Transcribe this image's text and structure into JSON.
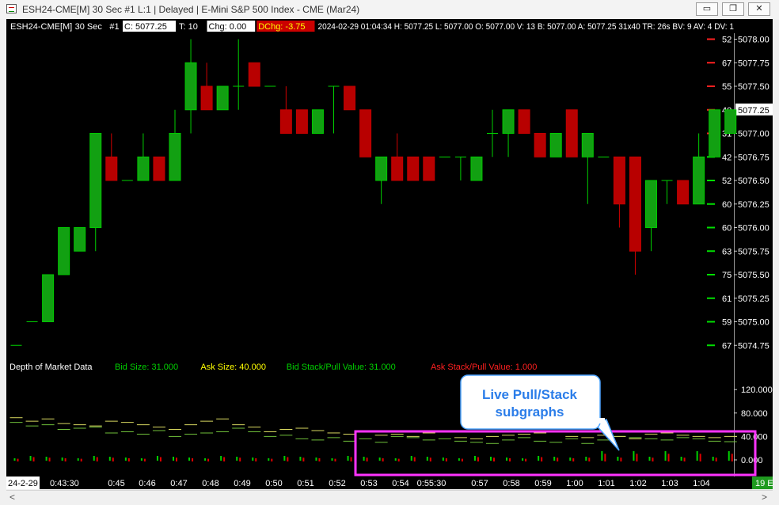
{
  "window": {
    "title": "ESH24-CME[M]  30 Sec  #1 L:1 | Delayed | E-Mini S&P 500 Index - CME (Mar24)",
    "minimize_glyph": "▭",
    "restore_glyph": "❐",
    "close_glyph": "✕"
  },
  "header": {
    "symbol": "ESH24-CME[M]",
    "interval": "30 Sec",
    "chart_num": "#1",
    "c_label": "C: 5077.25",
    "t_label": "T: 10",
    "chg_label": "Chg: 0.00",
    "dchg_label": "DChg: -3.75",
    "rest": "2024-02-29 01:04:34 H: 5077.25 L: 5077.00 O: 5077.00 V: 13 B: 5077.00 A: 5077.25 31x40 TR: 26s BV: 9 AV: 4 DV: 1"
  },
  "price_axis": {
    "labels": [
      "5078.00",
      "5077.75",
      "5077.50",
      "5077.25",
      "5077.00",
      "5076.75",
      "5076.50",
      "5076.25",
      "5076.00",
      "5075.75",
      "5075.50",
      "5075.25",
      "5075.00",
      "5074.75"
    ],
    "current_price": "5077.25"
  },
  "dom_ladder": [
    {
      "price": 5078.0,
      "size": "52",
      "color": "#ff2020"
    },
    {
      "price": 5077.75,
      "size": "67",
      "color": "#ff2020"
    },
    {
      "price": 5077.5,
      "size": "55",
      "color": "#ff2020"
    },
    {
      "price": 5077.25,
      "size": "40",
      "color": "#ff2020"
    },
    {
      "price": 5077.0,
      "size": "31",
      "color": "#ff2020"
    },
    {
      "price": 5076.75,
      "size": "42",
      "color": "#00e000"
    },
    {
      "price": 5076.5,
      "size": "52",
      "color": "#00e000"
    },
    {
      "price": 5076.25,
      "size": "60",
      "color": "#00e000"
    },
    {
      "price": 5076.0,
      "size": "60",
      "color": "#00e000"
    },
    {
      "price": 5075.75,
      "size": "63",
      "color": "#00e000"
    },
    {
      "price": 5075.5,
      "size": "75",
      "color": "#00e000"
    },
    {
      "price": 5075.25,
      "size": "61",
      "color": "#00e000"
    },
    {
      "price": 5075.0,
      "size": "59",
      "color": "#00e000"
    },
    {
      "price": 5074.75,
      "size": "67",
      "color": "#00e000"
    }
  ],
  "study": {
    "name": "Depth of Market Data",
    "bid_size": "Bid Size: 31.000",
    "ask_size": "Ask Size: 40.000",
    "bid_stack": "Bid Stack/Pull Value: 31.000",
    "ask_stack": "Ask Stack/Pull Value: 1.000",
    "axis_labels": [
      "120.000",
      "80.000",
      "40.000",
      "0.000"
    ]
  },
  "time_axis": {
    "date_label": "24-2-29",
    "first_label": "0:43:30",
    "labels": [
      "0:45",
      "0:46",
      "0:47",
      "0:48",
      "0:49",
      "0:50",
      "0:51",
      "0:52",
      "0:53",
      "0:54",
      "0:55:30",
      "0:57",
      "0:58",
      "0:59",
      "1:00",
      "1:01",
      "1:02",
      "1:03",
      "1:04"
    ],
    "bar_count_badge": "19 E"
  },
  "annotation": {
    "text_line1": "Live Pull/Stack",
    "text_line2": "subgraphs"
  },
  "scrollbar": {
    "left_arrow": "<",
    "right_arrow": ">"
  },
  "colors": {
    "up": "#00c800",
    "down": "#c00000",
    "up_fill": "#12a012",
    "down_fill": "#b80000",
    "wick_up": "#00d000",
    "wick_down": "#d00000",
    "highlight_box": "#ff33ff",
    "callout_border": "#4da3ff",
    "callout_text": "#2b7de9",
    "bid_text": "#00d000",
    "ask_text": "#ffff00",
    "ask_stack_text": "#ff2020"
  },
  "chart_data": {
    "type": "candlestick",
    "price_unit": "USD",
    "bars": [
      {
        "o": 5074.75,
        "h": 5074.75,
        "l": 5074.75,
        "c": 5074.75
      },
      {
        "o": 5075.0,
        "h": 5075.0,
        "l": 5075.0,
        "c": 5075.0
      },
      {
        "o": 5075.0,
        "h": 5075.5,
        "l": 5075.0,
        "c": 5075.5
      },
      {
        "o": 5075.5,
        "h": 5076.0,
        "l": 5075.5,
        "c": 5076.0
      },
      {
        "o": 5075.75,
        "h": 5076.0,
        "l": 5075.75,
        "c": 5076.0
      },
      {
        "o": 5076.0,
        "h": 5077.0,
        "l": 5075.75,
        "c": 5077.0
      },
      {
        "o": 5076.75,
        "h": 5077.0,
        "l": 5076.5,
        "c": 5076.5
      },
      {
        "o": 5076.5,
        "h": 5076.5,
        "l": 5076.5,
        "c": 5076.5
      },
      {
        "o": 5076.5,
        "h": 5077.0,
        "l": 5076.5,
        "c": 5076.75
      },
      {
        "o": 5076.75,
        "h": 5076.75,
        "l": 5076.5,
        "c": 5076.5
      },
      {
        "o": 5076.5,
        "h": 5077.25,
        "l": 5076.5,
        "c": 5077.0
      },
      {
        "o": 5077.25,
        "h": 5078.0,
        "l": 5077.0,
        "c": 5077.75
      },
      {
        "o": 5077.5,
        "h": 5077.75,
        "l": 5077.25,
        "c": 5077.25
      },
      {
        "o": 5077.25,
        "h": 5077.5,
        "l": 5077.25,
        "c": 5077.5
      },
      {
        "o": 5077.5,
        "h": 5078.0,
        "l": 5077.25,
        "c": 5077.5
      },
      {
        "o": 5077.75,
        "h": 5077.75,
        "l": 5077.5,
        "c": 5077.5
      },
      {
        "o": 5077.5,
        "h": 5077.5,
        "l": 5077.5,
        "c": 5077.5
      },
      {
        "o": 5077.25,
        "h": 5077.5,
        "l": 5077.0,
        "c": 5077.0
      },
      {
        "o": 5077.25,
        "h": 5077.25,
        "l": 5077.0,
        "c": 5077.0
      },
      {
        "o": 5077.0,
        "h": 5077.25,
        "l": 5077.0,
        "c": 5077.25
      },
      {
        "o": 5077.5,
        "h": 5077.5,
        "l": 5077.0,
        "c": 5077.5
      },
      {
        "o": 5077.5,
        "h": 5077.5,
        "l": 5077.25,
        "c": 5077.25
      },
      {
        "o": 5077.25,
        "h": 5077.25,
        "l": 5076.75,
        "c": 5076.75
      },
      {
        "o": 5076.5,
        "h": 5076.75,
        "l": 5076.25,
        "c": 5076.75
      },
      {
        "o": 5076.75,
        "h": 5077.0,
        "l": 5076.5,
        "c": 5076.5
      },
      {
        "o": 5076.75,
        "h": 5076.75,
        "l": 5076.5,
        "c": 5076.5
      },
      {
        "o": 5076.75,
        "h": 5076.75,
        "l": 5076.5,
        "c": 5076.5
      },
      {
        "o": 5076.75,
        "h": 5076.75,
        "l": 5076.75,
        "c": 5076.75
      },
      {
        "o": 5076.75,
        "h": 5076.75,
        "l": 5076.5,
        "c": 5076.75
      },
      {
        "o": 5076.5,
        "h": 5076.75,
        "l": 5076.5,
        "c": 5076.75
      },
      {
        "o": 5077.0,
        "h": 5077.25,
        "l": 5076.75,
        "c": 5077.0
      },
      {
        "o": 5077.0,
        "h": 5077.25,
        "l": 5076.75,
        "c": 5077.25
      },
      {
        "o": 5077.25,
        "h": 5077.25,
        "l": 5077.0,
        "c": 5077.0
      },
      {
        "o": 5077.0,
        "h": 5077.0,
        "l": 5076.75,
        "c": 5076.75
      },
      {
        "o": 5076.75,
        "h": 5077.0,
        "l": 5076.75,
        "c": 5077.0
      },
      {
        "o": 5077.25,
        "h": 5077.25,
        "l": 5076.75,
        "c": 5076.75
      },
      {
        "o": 5076.75,
        "h": 5077.0,
        "l": 5076.25,
        "c": 5077.0
      },
      {
        "o": 5076.75,
        "h": 5076.75,
        "l": 5076.75,
        "c": 5076.75
      },
      {
        "o": 5076.75,
        "h": 5076.75,
        "l": 5076.0,
        "c": 5076.25
      },
      {
        "o": 5076.75,
        "h": 5076.75,
        "l": 5075.5,
        "c": 5075.75
      },
      {
        "o": 5076.0,
        "h": 5076.5,
        "l": 5075.75,
        "c": 5076.5
      },
      {
        "o": 5076.5,
        "h": 5076.5,
        "l": 5076.25,
        "c": 5076.5
      },
      {
        "o": 5076.5,
        "h": 5076.5,
        "l": 5076.25,
        "c": 5076.25
      },
      {
        "o": 5076.25,
        "h": 5077.0,
        "l": 5076.25,
        "c": 5076.75
      },
      {
        "o": 5076.75,
        "h": 5077.25,
        "l": 5076.75,
        "c": 5077.25
      },
      {
        "o": 5077.0,
        "h": 5077.25,
        "l": 5077.0,
        "c": 5077.25
      }
    ]
  }
}
